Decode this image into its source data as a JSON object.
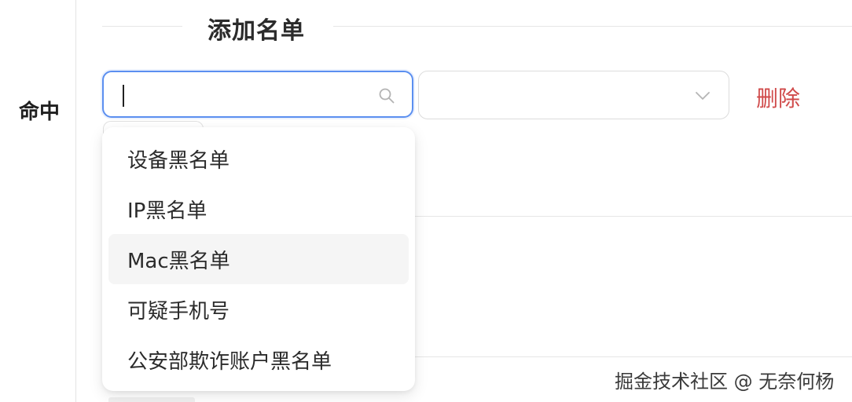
{
  "form": {
    "row_label": "命中",
    "section_title": "添加名单",
    "search": {
      "value": "",
      "placeholder": "",
      "icon": "search-icon"
    },
    "select": {
      "value": "",
      "icon": "chevron-down-icon"
    },
    "delete_label": "删除"
  },
  "dropdown": {
    "options": [
      {
        "label": "设备黑名单"
      },
      {
        "label": "IP黑名单"
      },
      {
        "label": "Mac黑名单",
        "highlighted": true
      },
      {
        "label": "可疑手机号"
      },
      {
        "label": "公安部欺诈账户黑名单"
      }
    ]
  },
  "watermark": "掘金技术社区 @ 无奈何杨",
  "colors": {
    "focus_border": "#5b8ff0",
    "danger": "#d04a4a",
    "hover_bg": "#f5f5f5"
  }
}
